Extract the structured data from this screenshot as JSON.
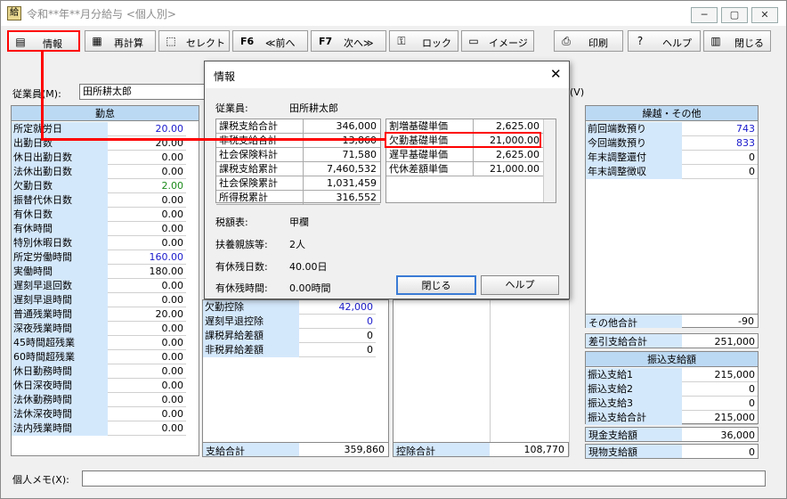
{
  "window": {
    "title": "令和**年**月分給与 <個人別>"
  },
  "toolbar": {
    "info": "情報",
    "recalc": "再計算",
    "select": "セレクト",
    "prev_key": "F6",
    "prev": "≪前へ",
    "next_key": "F7",
    "next": "次へ≫",
    "lock": "ロック",
    "image": "イメージ",
    "print": "印刷",
    "help": "ヘルプ",
    "close": "閉じる"
  },
  "employee": {
    "label": "従業員(M):",
    "name": "田所耕太郎",
    "v_label": "(V)"
  },
  "attendance": {
    "title": "勤怠",
    "items": [
      {
        "label": "所定就労日",
        "value": "20.00",
        "color": "blue"
      },
      {
        "label": "出勤日数",
        "value": "20.00",
        "color": "black"
      },
      {
        "label": "休日出勤日数",
        "value": "0.00",
        "color": "black"
      },
      {
        "label": "法休出勤日数",
        "value": "0.00",
        "color": "black"
      },
      {
        "label": "欠勤日数",
        "value": "2.00",
        "color": "green"
      },
      {
        "label": "振替代休日数",
        "value": "0.00",
        "color": "black"
      },
      {
        "label": "有休日数",
        "value": "0.00",
        "color": "black"
      },
      {
        "label": "有休時間",
        "value": "0.00",
        "color": "black"
      },
      {
        "label": "特別休暇日数",
        "value": "0.00",
        "color": "black"
      },
      {
        "label": "所定労働時間",
        "value": "160.00",
        "color": "blue"
      },
      {
        "label": "実働時間",
        "value": "180.00",
        "color": "black"
      },
      {
        "label": "遅刻早退回数",
        "value": "0.00",
        "color": "black"
      },
      {
        "label": "遅刻早退時間",
        "value": "0.00",
        "color": "black"
      },
      {
        "label": "普通残業時間",
        "value": "20.00",
        "color": "black"
      },
      {
        "label": "深夜残業時間",
        "value": "0.00",
        "color": "black"
      },
      {
        "label": "45時間超残業",
        "value": "0.00",
        "color": "black"
      },
      {
        "label": "60時間超残業",
        "value": "0.00",
        "color": "black"
      },
      {
        "label": "休日勤務時間",
        "value": "0.00",
        "color": "black"
      },
      {
        "label": "休日深夜時間",
        "value": "0.00",
        "color": "black"
      },
      {
        "label": "法休勤務時間",
        "value": "0.00",
        "color": "black"
      },
      {
        "label": "法休深夜時間",
        "value": "0.00",
        "color": "black"
      },
      {
        "label": "法内残業時間",
        "value": "0.00",
        "color": "black"
      }
    ]
  },
  "payments": {
    "items": [
      {
        "label": "欠勤控除",
        "value": "42,000",
        "color": "blue"
      },
      {
        "label": "遅刻早退控除",
        "value": "0",
        "color": "blue"
      },
      {
        "label": "課税昇給差額",
        "value": "0",
        "color": "black"
      },
      {
        "label": "非税昇給差額",
        "value": "0",
        "color": "black"
      }
    ],
    "total_label": "支給合計",
    "total_value": "359,860"
  },
  "deductions": {
    "total_label": "控除合計",
    "total_value": "108,770"
  },
  "carryover": {
    "title": "繰越・その他",
    "items": [
      {
        "label": "前回端数預り",
        "value": "743",
        "color": "blue"
      },
      {
        "label": "今回端数預り",
        "value": "833",
        "color": "blue"
      },
      {
        "label": "年末調整還付",
        "value": "0",
        "color": "black"
      },
      {
        "label": "年末調整徴収",
        "value": "0",
        "color": "black"
      }
    ],
    "other_label": "その他合計",
    "other_value": "-90"
  },
  "net": {
    "label": "差引支給合計",
    "value": "251,000"
  },
  "transfer": {
    "title": "振込支給額",
    "items": [
      {
        "label": "振込支給1",
        "value": "215,000"
      },
      {
        "label": "振込支給2",
        "value": "0"
      },
      {
        "label": "振込支給3",
        "value": "0"
      }
    ],
    "total_label": "振込支給合計",
    "total_value": "215,000"
  },
  "cash": {
    "label": "現金支給額",
    "value": "36,000"
  },
  "goods": {
    "label": "現物支給額",
    "value": "0"
  },
  "memo": {
    "label": "個人メモ(X):",
    "value": ""
  },
  "dialog": {
    "title": "情報",
    "employee_label": "従業員:",
    "employee_name": "田所耕太郎",
    "left_table": [
      {
        "label": "課税支給合計",
        "value": "346,000"
      },
      {
        "label": "非税支給合計",
        "value": "13,860"
      },
      {
        "label": "社会保険料計",
        "value": "71,580"
      },
      {
        "label": "課税支給累計",
        "value": "7,460,532"
      },
      {
        "label": "社会保険累計",
        "value": "1,031,459"
      },
      {
        "label": "所得税累計",
        "value": "316,552"
      }
    ],
    "right_table": [
      {
        "label": "割増基礎単価",
        "value": "2,625.00"
      },
      {
        "label": "欠勤基礎単価",
        "value": "21,000.00"
      },
      {
        "label": "遅早基礎単価",
        "value": "2,625.00"
      },
      {
        "label": "代休差額単価",
        "value": "21,000.00"
      }
    ],
    "tax_label": "税額表:",
    "tax_value": "甲欄",
    "dependents_label": "扶養親族等:",
    "dependents_value": "2人",
    "paid_leave_days_label": "有休残日数:",
    "paid_leave_days_value": "40.00日",
    "paid_leave_hours_label": "有休残時間:",
    "paid_leave_hours_value": "0.00時間",
    "close_btn": "閉じる",
    "help_btn": "ヘルプ"
  }
}
